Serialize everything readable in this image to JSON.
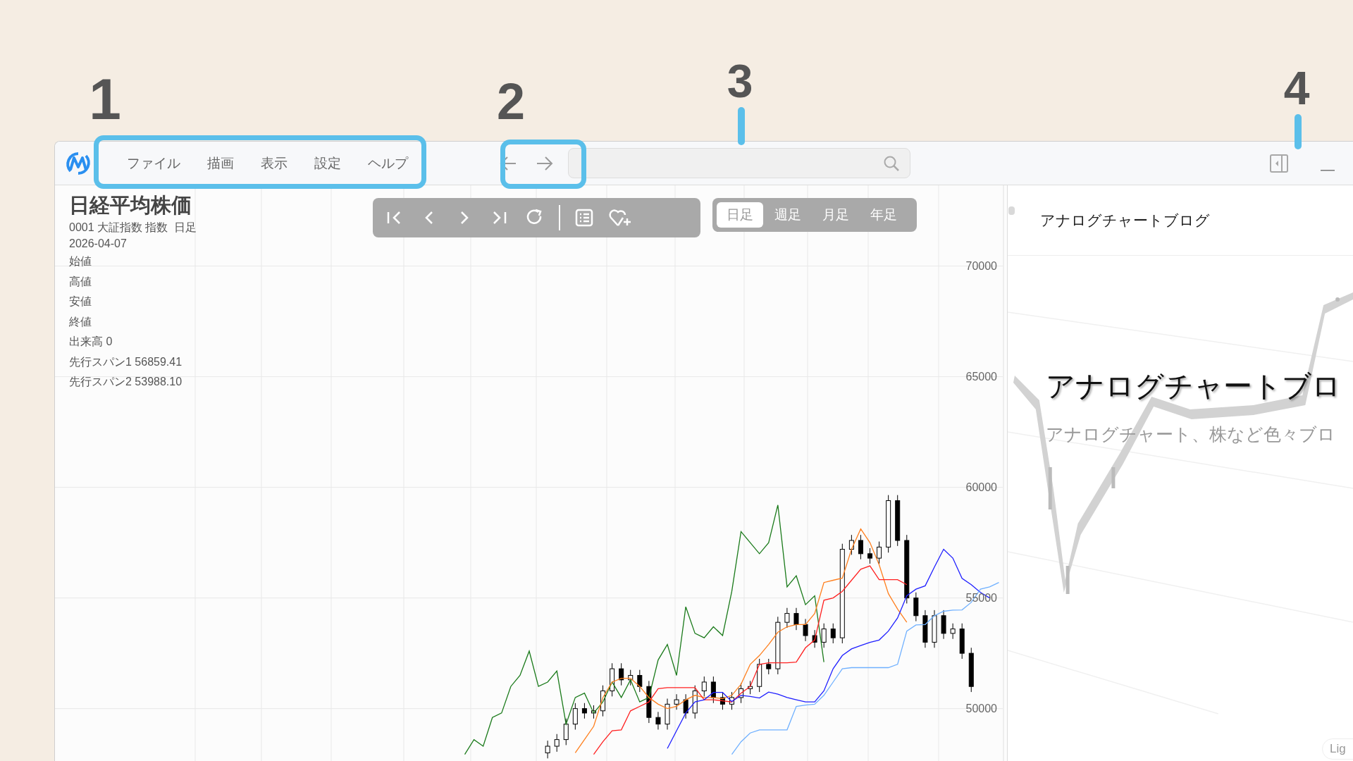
{
  "annotations": [
    {
      "label": "1"
    },
    {
      "label": "2"
    },
    {
      "label": "3"
    },
    {
      "label": "4"
    }
  ],
  "menu": [
    "ファイル",
    "描画",
    "表示",
    "設定",
    "ヘルプ"
  ],
  "instrument": {
    "title": "日経平均株価",
    "subtitle": "0001 大証指数 指数  日足",
    "date": "2026-04-07",
    "lines": [
      "始値",
      "高値",
      "安値",
      "終値",
      "出来高 0",
      "先行スパン1 56859.41",
      "先行スパン2 53988.10"
    ]
  },
  "period_tabs": [
    {
      "label": "日足",
      "selected": true
    },
    {
      "label": "週足",
      "selected": false
    },
    {
      "label": "月足",
      "selected": false
    },
    {
      "label": "年足",
      "selected": false
    }
  ],
  "chart_data": {
    "type": "candlestick",
    "grid": true,
    "categories": [
      null,
      null,
      null,
      null,
      null,
      null,
      null,
      null,
      null,
      null,
      null,
      null,
      null,
      null,
      null,
      null,
      null,
      null,
      null,
      null,
      null,
      null,
      null,
      null,
      null,
      null,
      null,
      null,
      null,
      null,
      null,
      null,
      null,
      null,
      null,
      null,
      null,
      null,
      null,
      null,
      null,
      null,
      null,
      null,
      null,
      null,
      null,
      null,
      null,
      null,
      null,
      null,
      null,
      null,
      null,
      null,
      null,
      null,
      null,
      null,
      null,
      null,
      null,
      null,
      null,
      null,
      null,
      null,
      null,
      null,
      null,
      null,
      null,
      null,
      null,
      null,
      null,
      null,
      null,
      null,
      null,
      null,
      null,
      null,
      null,
      null,
      null,
      null,
      null,
      null,
      null,
      null,
      null,
      null,
      null,
      null,
      null,
      null,
      null,
      null,
      null,
      null,
      null
    ],
    "ylim": [
      47600,
      73650
    ],
    "yticks": [
      50000,
      55000,
      60000,
      65000,
      70000
    ],
    "ohlc": [
      null,
      null,
      null,
      null,
      null,
      null,
      null,
      null,
      null,
      null,
      null,
      null,
      null,
      null,
      null,
      null,
      null,
      null,
      null,
      null,
      null,
      null,
      null,
      null,
      null,
      null,
      null,
      null,
      null,
      null,
      null,
      null,
      null,
      null,
      null,
      null,
      null,
      null,
      null,
      null,
      null,
      null,
      null,
      null,
      null,
      null,
      null,
      null,
      null,
      null,
      null,
      null,
      null,
      [
        48000,
        48550,
        47750,
        48300
      ],
      [
        48300,
        48850,
        48050,
        48600
      ],
      [
        48600,
        49550,
        48350,
        49300
      ],
      [
        49300,
        50250,
        49050,
        50000
      ],
      [
        50000,
        50250,
        49550,
        49800
      ],
      [
        49800,
        50150,
        49550,
        49900
      ],
      [
        49900,
        51050,
        49650,
        50800
      ],
      [
        50800,
        52050,
        50550,
        51800
      ],
      [
        51800,
        52050,
        51050,
        51300
      ],
      [
        51300,
        51750,
        51050,
        51500
      ],
      [
        51500,
        51750,
        50750,
        51000
      ],
      [
        51000,
        51250,
        49350,
        49600
      ],
      [
        49600,
        49850,
        49050,
        49300
      ],
      [
        49300,
        50450,
        49050,
        50200
      ],
      [
        50200,
        50650,
        49950,
        50400
      ],
      [
        50400,
        50650,
        49550,
        49800
      ],
      [
        49800,
        51050,
        49550,
        50800
      ],
      [
        50800,
        51450,
        50550,
        51200
      ],
      [
        51200,
        51450,
        50250,
        50500
      ],
      [
        50500,
        50750,
        49950,
        50200
      ],
      [
        50200,
        50750,
        49950,
        50500
      ],
      [
        50500,
        51150,
        50250,
        50900
      ],
      [
        50900,
        51250,
        50650,
        51000
      ],
      [
        51000,
        52250,
        50750,
        52000
      ],
      [
        52000,
        52250,
        51550,
        51800
      ],
      [
        51800,
        54150,
        51550,
        53900
      ],
      [
        53900,
        54550,
        53650,
        54300
      ],
      [
        54300,
        54550,
        53550,
        53800
      ],
      [
        53800,
        54050,
        53050,
        53300
      ],
      [
        53300,
        53550,
        52750,
        53000
      ],
      [
        53000,
        53850,
        52750,
        53600
      ],
      [
        53600,
        53850,
        52950,
        53200
      ],
      [
        53200,
        57450,
        52950,
        57200
      ],
      [
        57200,
        57850,
        56950,
        57600
      ],
      [
        57600,
        57850,
        56750,
        57000
      ],
      [
        57000,
        57250,
        56550,
        56800
      ],
      [
        56800,
        57550,
        56550,
        57300
      ],
      [
        57300,
        59650,
        57050,
        59400
      ],
      [
        59400,
        59650,
        57350,
        57600
      ],
      [
        57600,
        57850,
        54750,
        55000
      ],
      [
        55000,
        55250,
        53950,
        54200
      ],
      [
        54200,
        54450,
        52750,
        53000
      ],
      [
        53000,
        54450,
        52750,
        54200
      ],
      [
        54200,
        54450,
        53150,
        53400
      ],
      [
        53400,
        53850,
        53150,
        53600
      ],
      [
        53600,
        53850,
        52250,
        52500
      ],
      [
        52500,
        52750,
        50750,
        51000
      ],
      null,
      null,
      null
    ],
    "series": [
      {
        "type": "line",
        "color": "#1a7a1a",
        "values": [
          null,
          null,
          null,
          null,
          null,
          null,
          null,
          null,
          null,
          null,
          null,
          null,
          null,
          null,
          null,
          null,
          null,
          null,
          null,
          null,
          null,
          null,
          null,
          null,
          null,
          null,
          null,
          null,
          null,
          null,
          null,
          null,
          null,
          null,
          null,
          null,
          null,
          null,
          null,
          null,
          null,
          null,
          null,
          null,
          47930,
          48600,
          48300,
          49600,
          49800,
          51000,
          51500,
          52600,
          51000,
          51200,
          51700,
          49300,
          50500,
          50700,
          49800,
          50300,
          51200,
          50500,
          51300,
          50300,
          50500,
          52200,
          52900,
          51500,
          54600,
          53400,
          53200,
          53700,
          53300,
          55300,
          58000,
          57500,
          57000,
          57500,
          59200,
          55500,
          56000,
          54700,
          55100,
          52100,
          null,
          null,
          null,
          null,
          null,
          null,
          null,
          null,
          null,
          null,
          null,
          null,
          null,
          null,
          null,
          null,
          null,
          null,
          null
        ]
      },
      {
        "type": "line",
        "color": "#ff7f1e",
        "values": [
          null,
          null,
          null,
          null,
          null,
          null,
          null,
          null,
          null,
          null,
          null,
          null,
          null,
          null,
          null,
          null,
          null,
          null,
          null,
          null,
          null,
          null,
          null,
          null,
          null,
          null,
          null,
          null,
          null,
          null,
          null,
          null,
          null,
          null,
          null,
          null,
          null,
          null,
          null,
          null,
          null,
          null,
          null,
          null,
          null,
          null,
          null,
          null,
          null,
          null,
          null,
          null,
          null,
          null,
          null,
          null,
          48000,
          48600,
          49200,
          50500,
          51200,
          51370,
          51370,
          51000,
          50500,
          50200,
          50000,
          50100,
          50400,
          50600,
          50500,
          50500,
          50450,
          50600,
          51100,
          52000,
          52400,
          52900,
          53450,
          53700,
          53800,
          53800,
          54300,
          55700,
          55800,
          55900,
          57200,
          58120,
          57500,
          56500,
          55200,
          54500,
          53900,
          null,
          null,
          null,
          null,
          null,
          null,
          null,
          null,
          null,
          null
        ]
      },
      {
        "type": "line",
        "color": "#ff2020",
        "values": [
          null,
          null,
          null,
          null,
          null,
          null,
          null,
          null,
          null,
          null,
          null,
          null,
          null,
          null,
          null,
          null,
          null,
          null,
          null,
          null,
          null,
          null,
          null,
          null,
          null,
          null,
          null,
          null,
          null,
          null,
          null,
          null,
          null,
          null,
          null,
          null,
          null,
          null,
          null,
          null,
          null,
          null,
          null,
          null,
          null,
          null,
          null,
          null,
          null,
          null,
          null,
          null,
          null,
          null,
          null,
          null,
          null,
          null,
          47930,
          48500,
          49000,
          49040,
          49900,
          50100,
          50300,
          50900,
          50950,
          50950,
          50950,
          50950,
          50400,
          50400,
          50350,
          50300,
          50700,
          51000,
          52000,
          52070,
          52070,
          52070,
          52100,
          52750,
          53100,
          54900,
          55000,
          55300,
          55800,
          56300,
          56450,
          55830,
          55830,
          55830,
          55600,
          null,
          null,
          null,
          null,
          null,
          null,
          null,
          null,
          null,
          null
        ]
      },
      {
        "type": "line",
        "color": "#1f1fff",
        "values": [
          null,
          null,
          null,
          null,
          null,
          null,
          null,
          null,
          null,
          null,
          null,
          null,
          null,
          null,
          null,
          null,
          null,
          null,
          null,
          null,
          null,
          null,
          null,
          null,
          null,
          null,
          null,
          null,
          null,
          null,
          null,
          null,
          null,
          null,
          null,
          null,
          null,
          null,
          null,
          null,
          null,
          null,
          null,
          null,
          null,
          null,
          null,
          null,
          null,
          null,
          null,
          null,
          null,
          null,
          null,
          null,
          null,
          null,
          null,
          null,
          null,
          null,
          null,
          null,
          null,
          null,
          48200,
          49000,
          49800,
          50300,
          50400,
          50730,
          50730,
          50320,
          50600,
          50550,
          50480,
          50750,
          50650,
          50500,
          50400,
          50300,
          50300,
          50800,
          51800,
          52400,
          52700,
          52850,
          52990,
          53100,
          53500,
          54100,
          55100,
          55400,
          55550,
          56400,
          57200,
          56800,
          55890,
          55600,
          55250,
          55000,
          null
        ]
      },
      {
        "type": "line",
        "color": "#6fb0ff",
        "values": [
          null,
          null,
          null,
          null,
          null,
          null,
          null,
          null,
          null,
          null,
          null,
          null,
          null,
          null,
          null,
          null,
          null,
          null,
          null,
          null,
          null,
          null,
          null,
          null,
          null,
          null,
          null,
          null,
          null,
          null,
          null,
          null,
          null,
          null,
          null,
          null,
          null,
          null,
          null,
          null,
          null,
          null,
          null,
          null,
          null,
          null,
          null,
          null,
          null,
          null,
          null,
          null,
          null,
          null,
          null,
          null,
          null,
          null,
          null,
          null,
          null,
          null,
          null,
          null,
          null,
          null,
          null,
          null,
          null,
          null,
          null,
          null,
          null,
          47930,
          48500,
          48900,
          49040,
          49040,
          49040,
          49040,
          50100,
          50160,
          50200,
          50600,
          51200,
          51800,
          51850,
          51850,
          51850,
          51850,
          51850,
          52000,
          53500,
          53780,
          53800,
          54200,
          54400,
          54450,
          54460,
          54800,
          55400,
          55500,
          55700
        ]
      }
    ]
  },
  "side_panel": {
    "header": "アナログチャートブログ",
    "banner_title": "アナログチャートブロ",
    "banner_subtitle": "アナログチャート、株など色々ブロ",
    "badge": "Lig"
  }
}
